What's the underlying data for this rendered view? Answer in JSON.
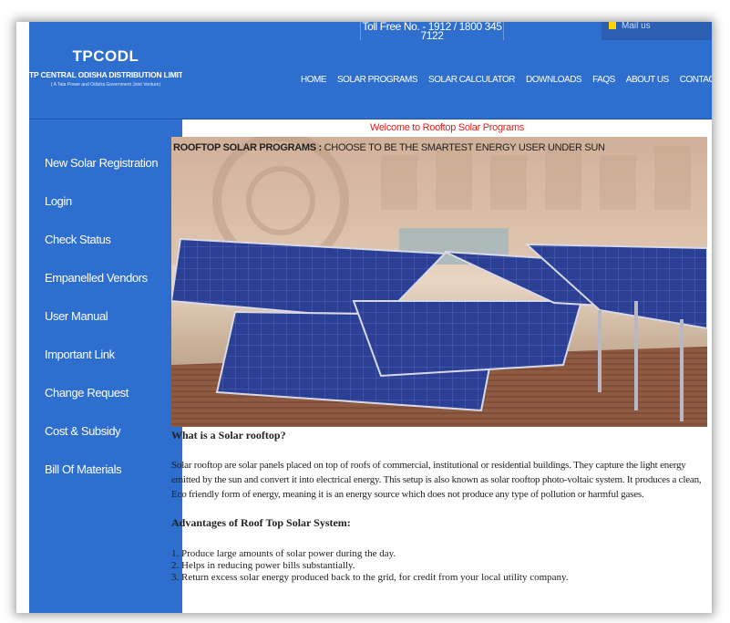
{
  "header": {
    "toll_free": "Toll Free No. - 1912 / 1800 345 7122",
    "mail_label": "Mail us"
  },
  "logo": {
    "mark": "TPCODL",
    "name": "TP CENTRAL ODISHA DISTRIBUTION LIMITED",
    "subtitle": "( A Tata Power and Odisha Government Joint Venture)"
  },
  "nav": {
    "items": [
      "HOME",
      "SOLAR PROGRAMS",
      "SOLAR CALCULATOR",
      "DOWNLOADS",
      "FAQS",
      "ABOUT US",
      "CONTACT US"
    ]
  },
  "sidebar": {
    "items": [
      {
        "label": "New Solar Registration"
      },
      {
        "label": "Login"
      },
      {
        "label": "Check Status"
      },
      {
        "label": "Empanelled Vendors"
      },
      {
        "label": "User Manual"
      },
      {
        "label": "Important Link"
      },
      {
        "label": "Change Request"
      },
      {
        "label": "Cost & Subsidy"
      },
      {
        "label": "Bill Of Materials"
      }
    ]
  },
  "main": {
    "welcome": "Welcome to Rooftop Solar Programs",
    "hero_title_bold": "ROOFTOP SOLAR PROGRAMS :",
    "hero_title_rest": " CHOOSE TO BE THE SMARTEST ENERGY USER UNDER SUN",
    "what_heading": "What is a Solar rooftop?",
    "what_text": "Solar rooftop are solar panels placed on top of roofs of commercial, institutional or residential buildings. They capture the light energy emitted by the sun and convert it into electrical energy. This setup is also known as solar rooftop photo-voltaic system. It produces a clean, Eco friendly form of energy, meaning it is an energy source which does not produce any type of pollution or harmful gases.",
    "advantages_heading": "Advantages of Roof Top Solar System:",
    "advantages": [
      "1. Produce large amounts of solar power during the day.",
      "2. Helps in reducing power bills substantially.",
      "3. Return excess solar energy produced back to the grid, for credit from your local utility company."
    ]
  },
  "colors": {
    "brand_blue": "#2e6ecf",
    "welcome_red": "#e0201b",
    "panel_blue": "#2a3f8f"
  }
}
